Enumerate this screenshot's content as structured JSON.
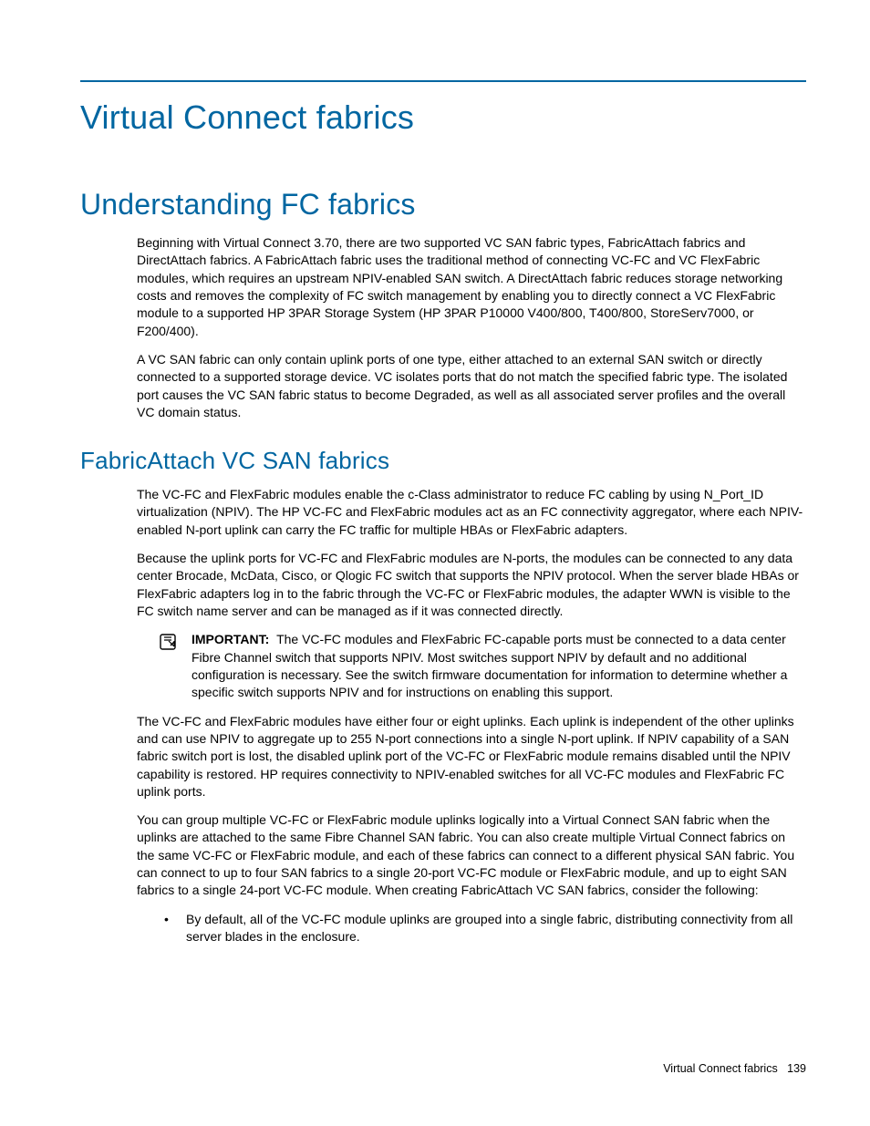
{
  "chapter_title": "Virtual Connect fabrics",
  "section_title": "Understanding FC fabrics",
  "para_1": "Beginning with Virtual Connect 3.70, there are two supported VC SAN fabric types, FabricAttach fabrics and DirectAttach fabrics. A FabricAttach fabric uses the traditional method of connecting VC-FC and VC FlexFabric modules, which requires an upstream NPIV-enabled SAN switch. A DirectAttach fabric reduces storage networking costs and removes the complexity of FC switch management by enabling you to directly connect a VC FlexFabric module to a supported HP 3PAR Storage System (HP 3PAR P10000 V400/800, T400/800, StoreServ7000, or F200/400).",
  "para_2": "A VC SAN fabric can only contain uplink ports of one type, either attached to an external SAN switch or directly connected to a supported storage device. VC isolates ports that do not match the specified fabric type. The isolated port causes the VC SAN fabric status to become Degraded, as well as all associated server profiles and the overall VC domain status.",
  "subsection_title": "FabricAttach VC SAN fabrics",
  "para_3": "The VC-FC and FlexFabric modules enable the c-Class administrator to reduce FC cabling by using N_Port_ID virtualization (NPIV). The HP VC-FC and FlexFabric modules act as an FC connectivity aggregator, where each NPIV-enabled N-port uplink can carry the FC traffic for multiple HBAs or FlexFabric adapters.",
  "para_4": "Because the uplink ports for VC-FC and FlexFabric modules are N-ports, the modules can be connected to any data center Brocade, McData, Cisco, or Qlogic FC switch that supports the NPIV protocol. When the server blade HBAs or FlexFabric adapters log in to the fabric through the VC-FC or FlexFabric modules, the adapter WWN is visible to the FC switch name server and can be managed as if it was connected directly.",
  "important_label": "IMPORTANT:",
  "important_text": "The VC-FC modules and FlexFabric FC-capable ports must be connected to a data center Fibre Channel switch that supports NPIV. Most switches support NPIV by default and no additional configuration is necessary. See the switch firmware documentation for information to determine whether a specific switch supports NPIV and for instructions on enabling this support.",
  "para_5": "The VC-FC and FlexFabric modules have either four or eight uplinks. Each uplink is independent of the other uplinks and can use NPIV to aggregate up to 255 N-port connections into a single N-port uplink. If NPIV capability of a SAN fabric switch port is lost, the disabled uplink port of the VC-FC or FlexFabric module remains disabled until the NPIV capability is restored. HP requires connectivity to NPIV-enabled switches for all VC-FC modules and FlexFabric FC uplink ports.",
  "para_6": "You can group multiple VC-FC or FlexFabric module uplinks logically into a Virtual Connect SAN fabric when the uplinks are attached to the same Fibre Channel SAN fabric. You can also create multiple Virtual Connect fabrics on the same VC-FC or FlexFabric module, and each of these fabrics can connect to a different physical SAN fabric. You can connect to up to four SAN fabrics to a single 20-port VC-FC module or FlexFabric module, and up to eight SAN fabrics to a single 24-port VC-FC module. When creating FabricAttach VC SAN fabrics, consider the following:",
  "bullet_1": "By default, all of the VC-FC module uplinks are grouped into a single fabric, distributing connectivity from all server blades in the enclosure.",
  "footer_text": "Virtual Connect fabrics",
  "footer_page": "139"
}
